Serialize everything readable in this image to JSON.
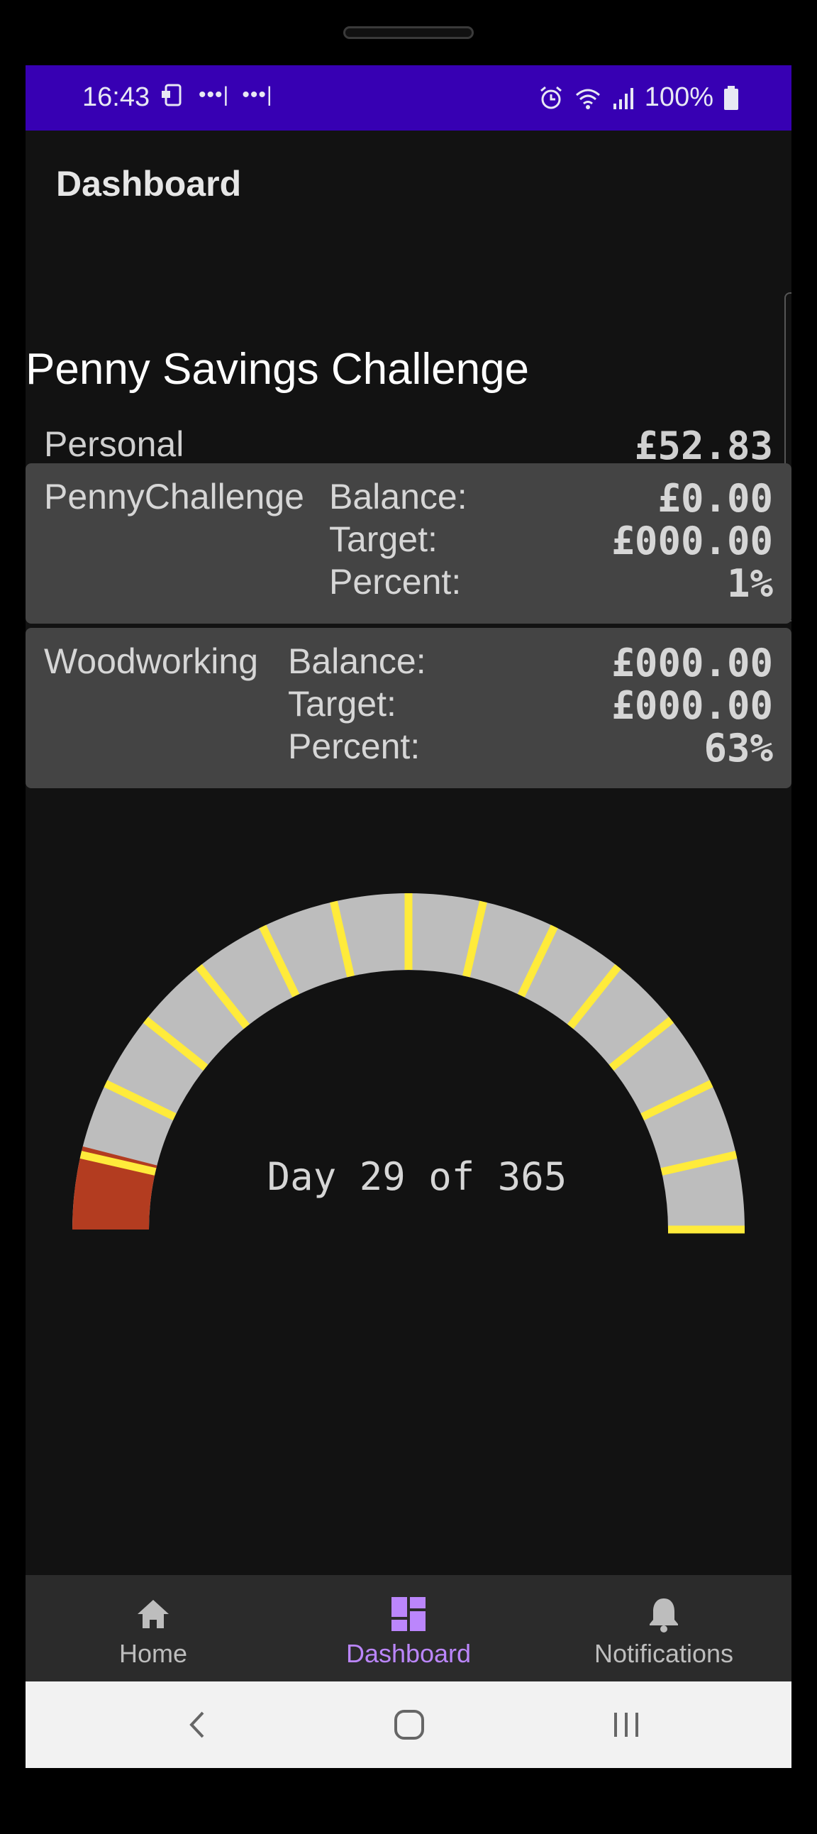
{
  "status_bar": {
    "time": "16:43",
    "battery": "100%",
    "icons": [
      "nfc-icon",
      "dots-icon",
      "dots-icon",
      "alarm-icon",
      "wifi-icon",
      "signal-icon",
      "battery-icon"
    ]
  },
  "app_bar": {
    "title": "Dashboard"
  },
  "challenge": {
    "title": "Penny Savings Challenge",
    "personal_label": "Personal",
    "personal_value": "£52.83"
  },
  "accounts": [
    {
      "name": "PennyChallenge",
      "balance_label": "Balance:",
      "balance": "£0.00",
      "target_label": "Target:",
      "target": "£000.00",
      "percent_label": "Percent:",
      "percent": "1%"
    },
    {
      "name": "Woodworking",
      "balance_label": "Balance:",
      "balance": "£000.00",
      "target_label": "Target:",
      "target": "£000.00",
      "percent_label": "Percent:",
      "percent": "63%"
    }
  ],
  "gauge": {
    "label": "Day 29 of 365",
    "day": 29,
    "total_days": 365,
    "colors": {
      "track": "#bdbdbd",
      "progress": "#b33c20",
      "ticks": "#ffeb3b"
    }
  },
  "bottom_nav": {
    "items": [
      {
        "label": "Home",
        "icon": "home-icon",
        "active": false
      },
      {
        "label": "Dashboard",
        "icon": "dashboard-icon",
        "active": true
      },
      {
        "label": "Notifications",
        "icon": "bell-icon",
        "active": false
      }
    ],
    "active_color": "#bb86fc",
    "inactive_color": "#bdbdbd"
  },
  "system_nav": {
    "buttons": [
      "back-icon",
      "home-circle-icon",
      "recents-icon"
    ]
  }
}
